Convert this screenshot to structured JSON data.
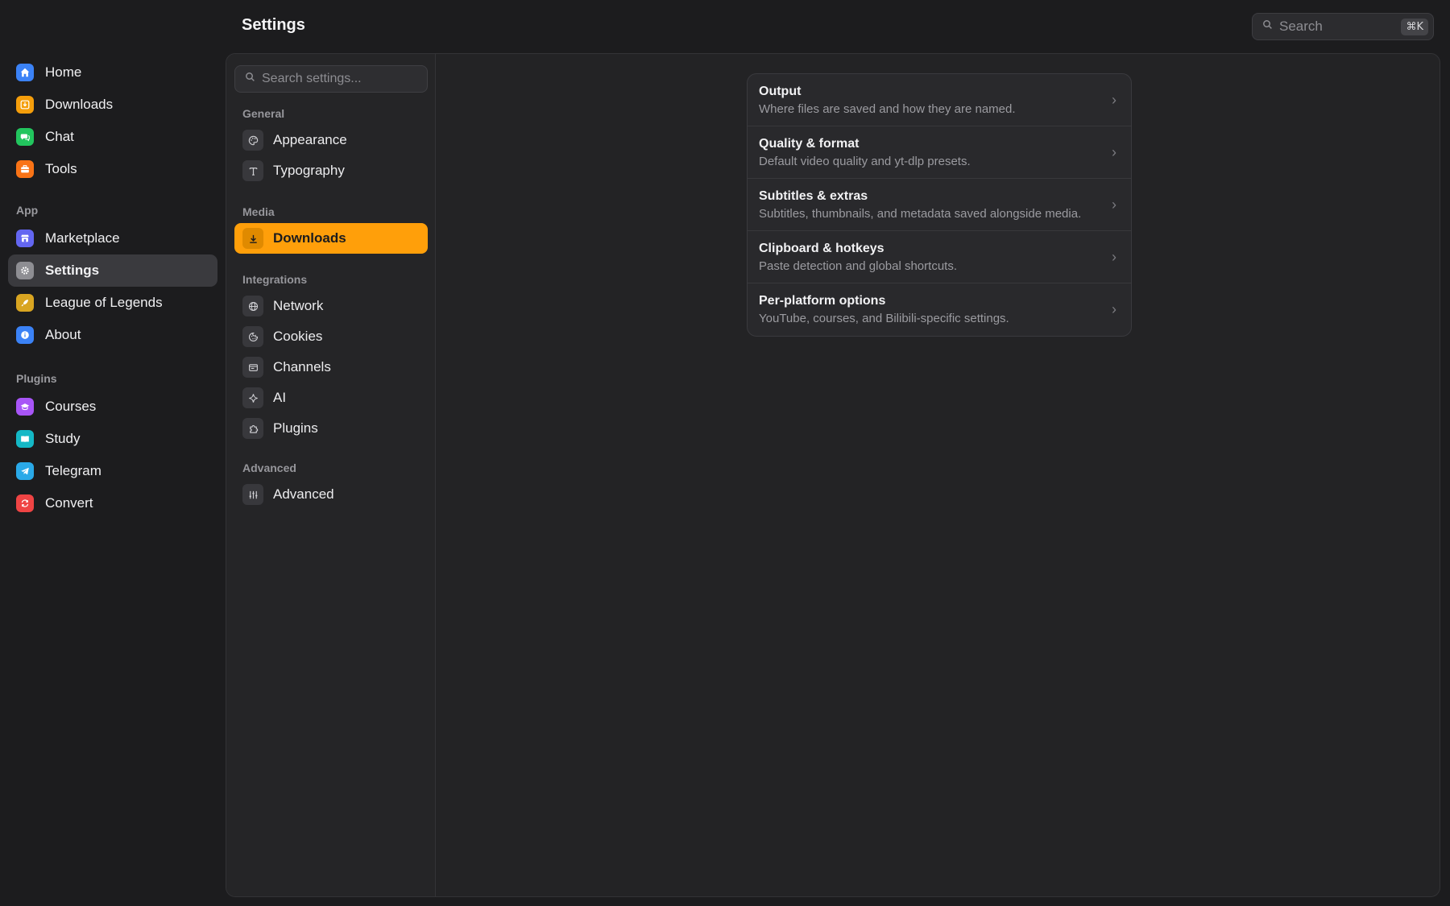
{
  "header": {
    "title": "Settings",
    "search_placeholder": "Search",
    "search_shortcut": "⌘K"
  },
  "app_sidebar": {
    "main_items": [
      {
        "label": "Home",
        "icon": "home-icon",
        "color": "#3b82f6"
      },
      {
        "label": "Downloads",
        "icon": "download-box-icon",
        "color": "#f59e0b"
      },
      {
        "label": "Chat",
        "icon": "chat-icon",
        "color": "#22c55e"
      },
      {
        "label": "Tools",
        "icon": "toolbox-icon",
        "color": "#f97316"
      }
    ],
    "app_label": "App",
    "app_items": [
      {
        "label": "Marketplace",
        "icon": "store-icon",
        "color": "#6366f1"
      },
      {
        "label": "Settings",
        "icon": "gear-icon",
        "color": "#8e8e93",
        "active": true
      },
      {
        "label": "League of Legends",
        "icon": "rocket-icon",
        "color": "#d9a521"
      },
      {
        "label": "About",
        "icon": "info-icon",
        "color": "#3b82f6"
      }
    ],
    "plugins_label": "Plugins",
    "plugin_items": [
      {
        "label": "Courses",
        "icon": "graduation-cap-icon",
        "color": "#a855f7"
      },
      {
        "label": "Study",
        "icon": "book-icon",
        "color": "#14b8c6"
      },
      {
        "label": "Telegram",
        "icon": "telegram-icon",
        "color": "#2aa9e8"
      },
      {
        "label": "Convert",
        "icon": "convert-icon",
        "color": "#ef4444"
      }
    ]
  },
  "settings_nav": {
    "search_placeholder": "Search settings...",
    "general_label": "General",
    "general_items": [
      "Appearance",
      "Typography"
    ],
    "media_label": "Media",
    "media_items": [
      "Downloads"
    ],
    "integrations_label": "Integrations",
    "integrations_items": [
      "Network",
      "Cookies",
      "Channels",
      "AI",
      "Plugins"
    ],
    "advanced_label": "Advanced",
    "advanced_items": [
      "Advanced"
    ],
    "active_color": "#ff9f0a"
  },
  "download_settings": [
    {
      "title": "Output",
      "desc": "Where files are saved and how they are named."
    },
    {
      "title": "Quality & format",
      "desc": "Default video quality and yt-dlp presets."
    },
    {
      "title": "Subtitles & extras",
      "desc": "Subtitles, thumbnails, and metadata saved alongside media."
    },
    {
      "title": "Clipboard & hotkeys",
      "desc": "Paste detection and global shortcuts."
    },
    {
      "title": "Per-platform options",
      "desc": "YouTube, courses, and Bilibili-specific settings."
    }
  ]
}
